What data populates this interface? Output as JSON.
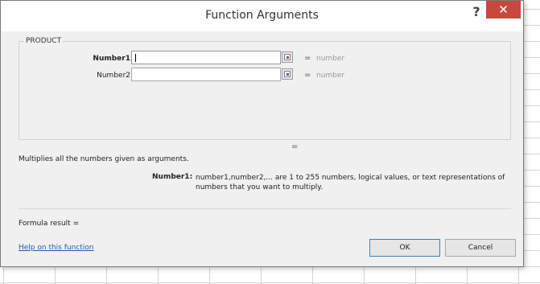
{
  "dialog": {
    "title": "Function Arguments",
    "help_glyph": "?",
    "close_glyph": "✕"
  },
  "function_group": {
    "name": "PRODUCT"
  },
  "arguments": [
    {
      "label": "Number1",
      "value": "",
      "result_hint": "number"
    },
    {
      "label": "Number2",
      "value": "",
      "result_hint": "number"
    }
  ],
  "formula_equals": "=",
  "equals_sign": "=",
  "description": "Multiplies all the numbers given as arguments.",
  "argument_help": {
    "name": "Number1:",
    "text": "number1,number2,... are 1 to 255 numbers, logical values, or text representations of numbers that you want to multiply."
  },
  "formula_result": "Formula result =",
  "help_link": "Help on this function",
  "buttons": {
    "ok": "OK",
    "cancel": "Cancel"
  },
  "colors": {
    "close_button": "#c9473d",
    "link": "#1f5ca8",
    "dialog_bg": "#f0f0f0"
  },
  "icons": {
    "collapse": "collapse-dialog-icon",
    "help": "help-icon",
    "close": "close-icon"
  }
}
